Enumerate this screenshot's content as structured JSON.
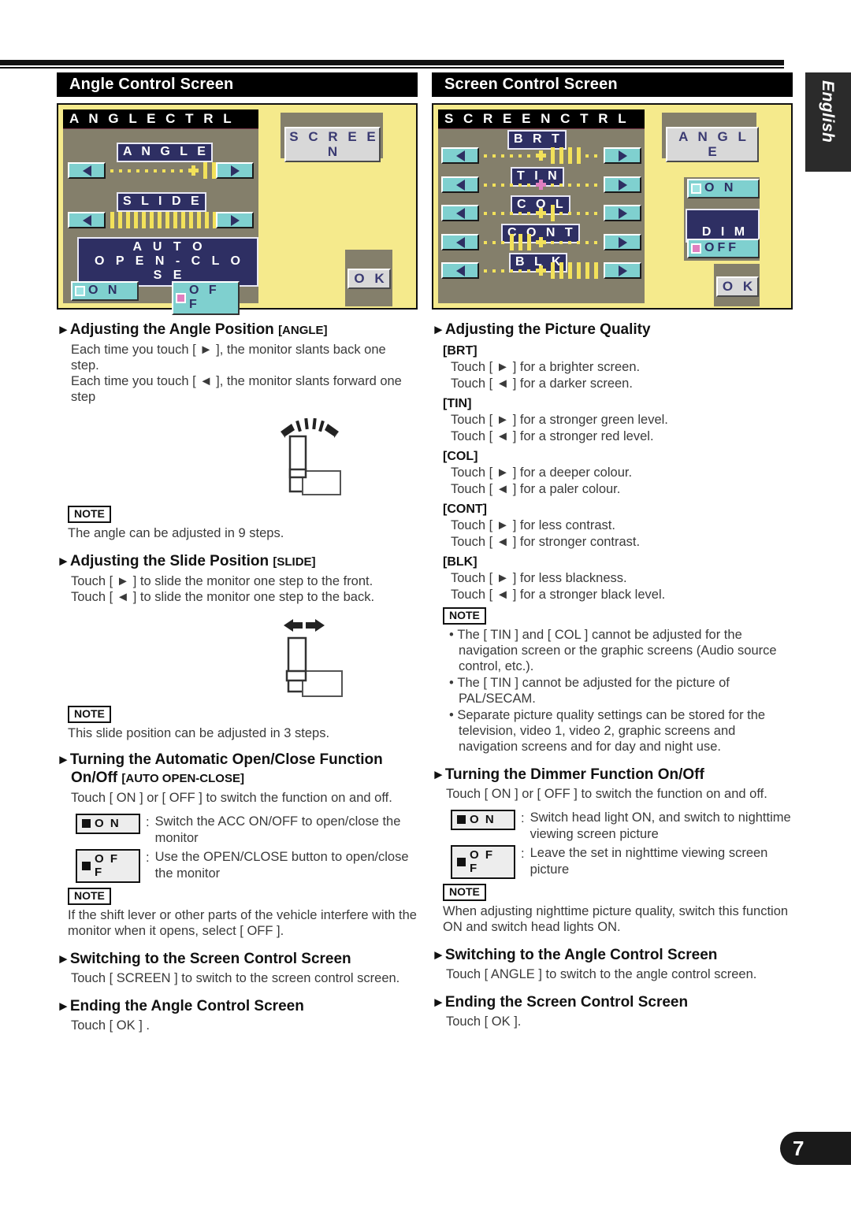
{
  "language_tab": "English",
  "page_number": "7",
  "left": {
    "section_title": "Angle Control Screen",
    "mock": {
      "title": "A N G L E   C T R L",
      "angle_label": "A N G L E",
      "slide_label": "S L I D E",
      "auto_label": "A U T O\nO P E N - C L O S E",
      "on_label": "O  N",
      "off_label": "O F F",
      "screen_button": "S C R E E N",
      "ok_button": "O K"
    },
    "sections": [
      {
        "heading": "Adjusting the Angle Position",
        "tag": "[ANGLE]",
        "body": "Each time you touch [ ► ], the monitor slants back one step.\nEach time you touch [ ◄ ], the monitor slants forward one step"
      },
      {
        "heading": "Adjusting the Slide Position",
        "tag": "[SLIDE]",
        "body": "Touch [ ► ] to slide the monitor one step to the front.\nTouch [ ◄ ] to slide the monitor one step to the back."
      },
      {
        "heading": "Turning the Automatic Open/Close Function On/Off",
        "tag": "[AUTO OPEN-CLOSE]",
        "body": "Touch [ ON ] or [ OFF ] to switch the function on and off."
      },
      {
        "heading": "Switching to the Screen Control Screen",
        "tag": "",
        "body": "Touch [ SCREEN ] to switch to the screen control screen."
      },
      {
        "heading": "Ending the Angle Control Screen",
        "tag": "",
        "body": "Touch [ OK ] ."
      }
    ],
    "note_label": "NOTE",
    "note_angle": "The angle can be adjusted in 9 steps.",
    "note_slide": "This slide position can be adjusted in 3 steps.",
    "note_auto": "If the shift lever or other parts of the vehicle interfere with the monitor when it opens, select [ OFF ].",
    "legend": [
      {
        "key": "O  N",
        "desc": "Switch the ACC ON/OFF to open/close the monitor"
      },
      {
        "key": "O F F",
        "desc": "Use the OPEN/CLOSE button to open/close the monitor"
      }
    ]
  },
  "right": {
    "section_title": "Screen Control Screen",
    "mock": {
      "title": "S C R E E N   C T R L",
      "brt_label": "B R T",
      "tin_label": "T I N",
      "col_label": "C O L",
      "cont_label": "C O N T",
      "blk_label": "B L K",
      "angle_button": "A N G L E",
      "on_label": "O N",
      "dim_label": "D I M",
      "off_label": "OFF",
      "ok_button": "O K"
    },
    "picture_quality": {
      "heading": "Adjusting the Picture Quality",
      "groups": [
        {
          "label": "[BRT]",
          "line1": "Touch [ ► ] for a brighter screen.",
          "line2": "Touch [ ◄ ] for a darker screen."
        },
        {
          "label": "[TIN]",
          "line1": "Touch [ ► ] for a stronger green level.",
          "line2": "Touch [ ◄ ] for a stronger red level."
        },
        {
          "label": "[COL]",
          "line1": "Touch [ ► ] for a deeper colour.",
          "line2": "Touch [ ◄ ] for a paler colour."
        },
        {
          "label": "[CONT]",
          "line1": "Touch [ ► ] for less contrast.",
          "line2": "Touch [ ◄ ] for stronger contrast."
        },
        {
          "label": "[BLK]",
          "line1": "Touch [ ► ] for less blackness.",
          "line2": "Touch [ ◄ ] for a stronger black level."
        }
      ]
    },
    "note_label": "NOTE",
    "note_bullets": [
      "The [ TIN ] and [ COL ] cannot be adjusted for the navigation screen or the graphic screens (Audio source control, etc.).",
      "The [ TIN ] cannot be adjusted for the picture of PAL/SECAM.",
      "Separate picture quality settings can be stored for the television, video 1, video 2, graphic screens and navigation screens and for day and night use."
    ],
    "dimmer": {
      "heading": "Turning the Dimmer Function On/Off",
      "body": "Touch [ ON ] or [ OFF ] to switch the function on and off."
    },
    "legend": [
      {
        "key": "O  N",
        "desc": "Switch head light ON, and switch to nighttime viewing screen picture"
      },
      {
        "key": "O F F",
        "desc": "Leave the set in nighttime viewing screen picture"
      }
    ],
    "note_dimmer": "When adjusting nighttime picture quality, switch this function ON and switch head lights ON.",
    "sections": [
      {
        "heading": "Switching to the Angle Control Screen",
        "body": "Touch [ ANGLE ] to switch to the angle control screen."
      },
      {
        "heading": "Ending the Screen Control Screen",
        "body": "Touch [ OK ]."
      }
    ]
  },
  "colors": {
    "screen_bezel": "#f5ea8c",
    "screen_face": "#847f6b",
    "button_teal": "#7fd0cf",
    "label_navy": "#2e2f63",
    "slider_yellow": "#f2e15a",
    "cursor_pink": "#e07fc0"
  }
}
